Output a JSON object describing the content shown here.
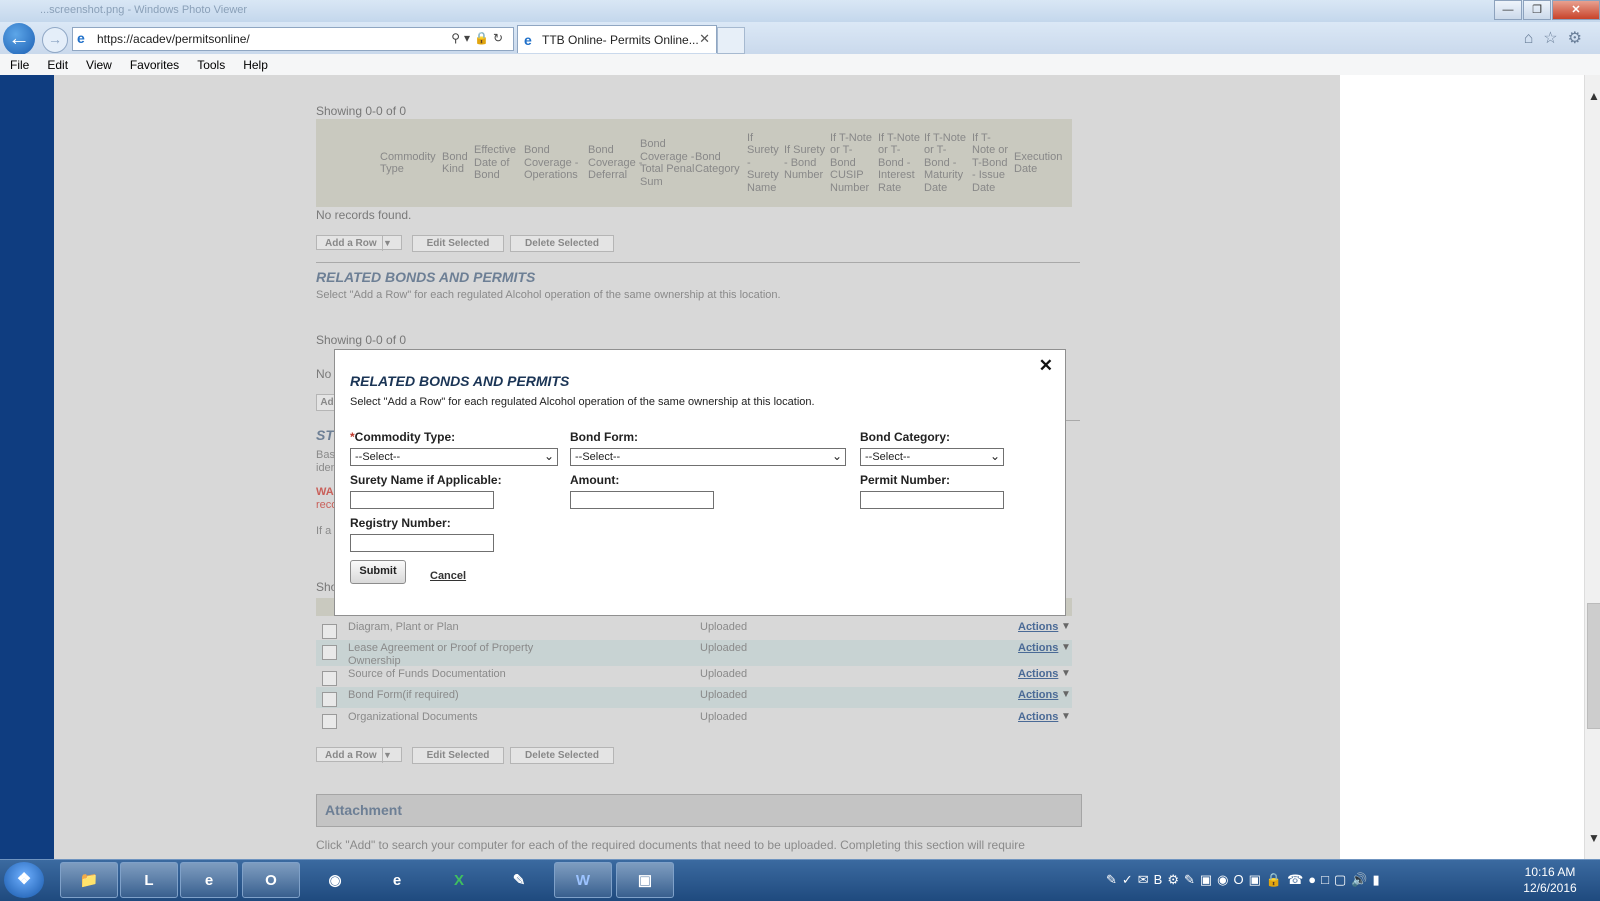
{
  "browser": {
    "window_title": "...screenshot.png - Windows Photo Viewer",
    "url": "https://acadev/permitsonline/",
    "tab_title": "TTB Online- Permits Online...",
    "menu": [
      "File",
      "Edit",
      "View",
      "Favorites",
      "Tools",
      "Help"
    ],
    "win_min": "—",
    "win_max": "❐",
    "win_close": "✕"
  },
  "bonds_grid": {
    "showing": "Showing 0-0 of 0",
    "columns": [
      "Commodity Type",
      "Bond Kind",
      "Effective Date of Bond",
      "Bond Coverage - Operations",
      "Bond Coverage - Deferral",
      "Bond Coverage - Total Penal Sum",
      "Bond Category",
      "If Surety - Surety Name",
      "If Surety - Bond Number",
      "If T-Note or T-Bond CUSIP Number",
      "If T-Note or T-Bond - Interest Rate",
      "If T-Note or T-Bond - Maturity Date",
      "If T-Note or T-Bond - Issue Date",
      "Execution Date"
    ],
    "no_records": "No records found.",
    "add_row": "Add a Row",
    "edit_selected": "Edit Selected",
    "delete_selected": "Delete Selected"
  },
  "related_section": {
    "title": "RELATED BONDS AND PERMITS",
    "description": "Select \"Add a Row\" for each regulated Alcohol operation of the same ownership at this location.",
    "showing": "Showing 0-0 of 0",
    "no_records_partial": "No",
    "add_partial": "Ad"
  },
  "hidden_section": {
    "title_partial": "ST",
    "text1_partial": "Bas",
    "text2_partial": "iden",
    "warn1_partial": "WA",
    "warn2_partial": "reco",
    "text3_partial": "If a",
    "show_partial": "Sho"
  },
  "documents": {
    "rows": [
      {
        "name": "Diagram, Plant or Plan",
        "status": "Uploaded",
        "action": "Actions"
      },
      {
        "name": "Lease Agreement or Proof of Property Ownership",
        "status": "Uploaded",
        "action": "Actions"
      },
      {
        "name": "Source of Funds Documentation",
        "status": "Uploaded",
        "action": "Actions"
      },
      {
        "name": "Bond Form(if required)",
        "status": "Uploaded",
        "action": "Actions"
      },
      {
        "name": "Organizational Documents",
        "status": "Uploaded",
        "action": "Actions"
      }
    ],
    "add_row": "Add a Row",
    "edit_selected": "Edit Selected",
    "delete_selected": "Delete Selected"
  },
  "attachment": {
    "title": "Attachment",
    "text": "Click \"Add\" to search your computer for each of the required documents that need to be uploaded.  Completing this section will require"
  },
  "modal": {
    "title": "RELATED BONDS AND PERMITS",
    "description": "Select \"Add a Row\" for each regulated Alcohol operation of the same ownership at this location.",
    "close": "✕",
    "commodity_label": "Commodity Type:",
    "required_mark": "*",
    "commodity_value": "--Select--",
    "bond_form_label": "Bond Form:",
    "bond_form_value": "--Select--",
    "bond_category_label": "Bond Category:",
    "bond_category_value": "--Select--",
    "surety_label": "Surety Name if Applicable:",
    "amount_label": "Amount:",
    "permit_label": "Permit Number:",
    "registry_label": "Registry Number:",
    "submit": "Submit",
    "cancel": "Cancel"
  },
  "taskbar": {
    "apps": [
      "explorer",
      "lync",
      "internet-explorer",
      "outlook",
      "chrome-like",
      "internet-explorer-2",
      "excel",
      "notepad",
      "word",
      "photo-viewer"
    ],
    "time": "10:16 AM",
    "date": "12/6/2016"
  }
}
